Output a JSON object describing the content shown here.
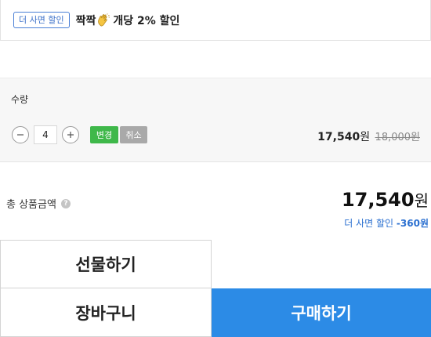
{
  "promo": {
    "badge": "더 사면 할인",
    "text_before": "짝짝",
    "icon": "clapping-hands-icon",
    "text_after": " 개당 2% 할인"
  },
  "quantity": {
    "label": "수량",
    "value": "4",
    "minus_icon": "minus-icon",
    "plus_icon": "plus-icon",
    "apply_label": "변경",
    "cancel_label": "취소",
    "sale_price": "17,540",
    "won": "원",
    "original_price": "18,000원"
  },
  "total": {
    "label": "총 상품금액",
    "help_icon": "question-icon",
    "help_glyph": "?",
    "price": "17,540",
    "won": "원",
    "discount_label": "더 사면 할인 ",
    "discount_amount": "-360원"
  },
  "actions": {
    "gift_label": "선물하기",
    "cart_label": "장바구니",
    "buy_label": "구매하기"
  },
  "colors": {
    "accent_blue": "#2c8be6",
    "apply_green": "#3fb84a",
    "cancel_gray": "#a9a9a9",
    "discount_blue": "#2a6fd0"
  }
}
